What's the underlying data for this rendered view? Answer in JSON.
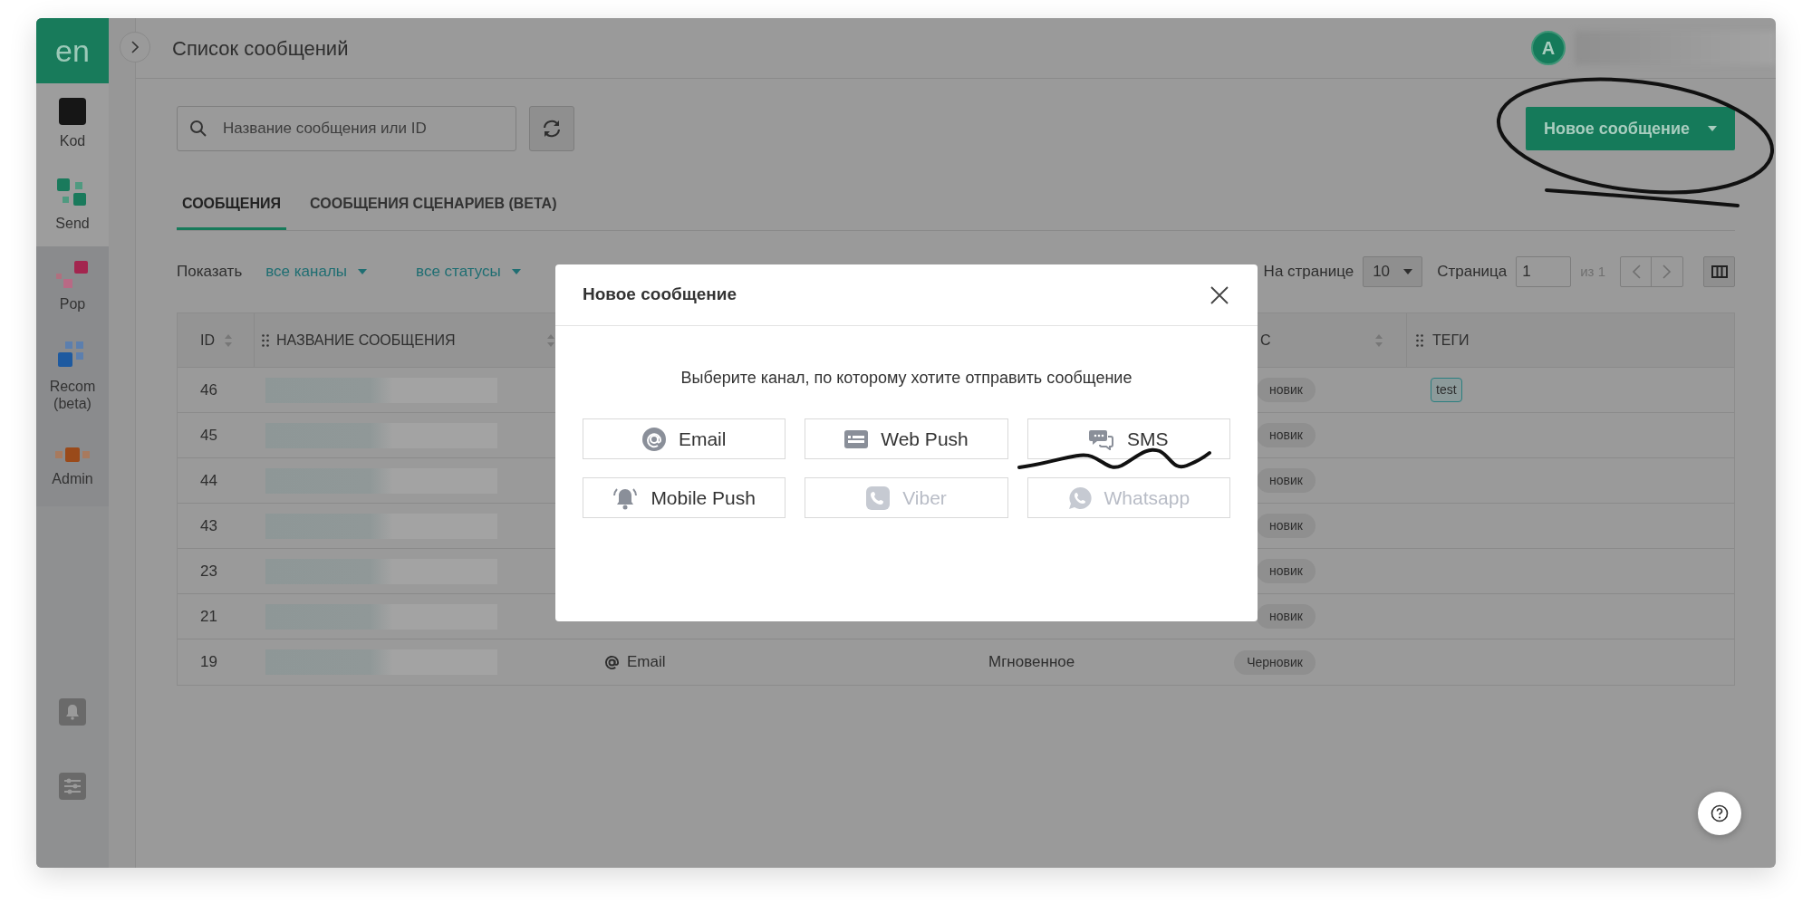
{
  "app": {
    "logo": "en",
    "page_title": "Список сообщений",
    "avatar": "A"
  },
  "sidebar": {
    "items": [
      {
        "label": "Kod",
        "kind": "kod",
        "highlighted": true
      },
      {
        "label": "Send",
        "kind": "send",
        "highlighted": true
      },
      {
        "label": "Pop",
        "kind": "pop",
        "highlighted": false
      },
      {
        "label": "Recom (beta)",
        "kind": "recom",
        "highlighted": false
      },
      {
        "label": "Admin",
        "kind": "admin",
        "highlighted": false
      }
    ]
  },
  "search": {
    "placeholder": "Название сообщения или ID"
  },
  "new_message_button": {
    "label": "Новое сообщение"
  },
  "tabs": [
    {
      "label": "СООБЩЕНИЯ",
      "selected": true
    },
    {
      "label": "СООБЩЕНИЯ СЦЕНАРИЕВ (BETA)",
      "selected": false
    }
  ],
  "filters": {
    "label": "Показать",
    "channel": "все каналы",
    "status": "все статусы"
  },
  "pagination": {
    "per_page_label": "На странице",
    "per_page": "10",
    "page_label": "Страница",
    "page": "1",
    "total": "из 1"
  },
  "table": {
    "columns": {
      "id": "ID",
      "name": "НАЗВАНИЕ СООБЩЕНИЯ",
      "status": "С",
      "tags": "ТЕГИ"
    },
    "rows": [
      {
        "id": "46",
        "status": "новик",
        "tags": [
          "test"
        ]
      },
      {
        "id": "45",
        "status": "новик"
      },
      {
        "id": "44",
        "status": "новик"
      },
      {
        "id": "43",
        "status": "новик"
      },
      {
        "id": "23",
        "status": "новик"
      },
      {
        "id": "21",
        "status": "новик"
      },
      {
        "id": "19",
        "channel": "Email",
        "type": "Мгновенное",
        "status": "Черновик"
      }
    ]
  },
  "modal": {
    "title": "Новое сообщение",
    "prompt": "Выберите канал, по которому хотите отправить сообщение",
    "channels": [
      {
        "label": "Email",
        "kind": "email",
        "disabled": false
      },
      {
        "label": "Web Push",
        "kind": "webpush",
        "disabled": false
      },
      {
        "label": "SMS",
        "kind": "sms",
        "disabled": false
      },
      {
        "label": "Mobile Push",
        "kind": "mobilepush",
        "disabled": false
      },
      {
        "label": "Viber",
        "kind": "viber",
        "disabled": true
      },
      {
        "label": "Whatsapp",
        "kind": "whatsapp",
        "disabled": true
      }
    ]
  }
}
